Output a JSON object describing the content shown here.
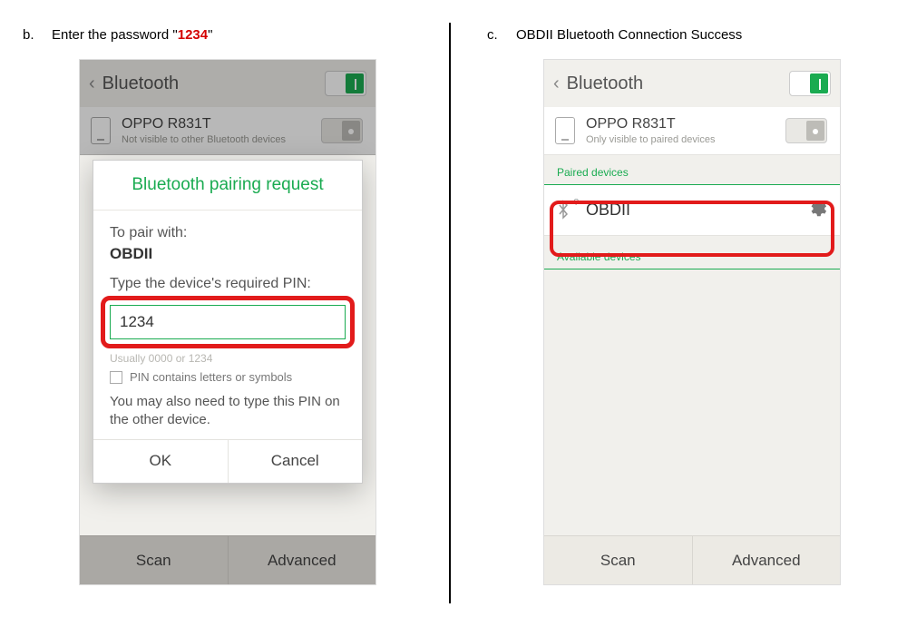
{
  "captions": {
    "b_letter": "b.",
    "b_prefix": "Enter the password \"",
    "b_password": "1234",
    "b_suffix": "\"",
    "c_letter": "c.",
    "c_text": "OBDII Bluetooth Connection Success"
  },
  "screen_b": {
    "title": "Bluetooth",
    "device": {
      "name": "OPPO R831T",
      "sub": "Not visible to other Bluetooth devices"
    },
    "footer": {
      "scan": "Scan",
      "advanced": "Advanced"
    },
    "dialog": {
      "title": "Bluetooth pairing request",
      "pair_label": "To pair with:",
      "pair_target": "OBDII",
      "pin_prompt": "Type the device's required PIN:",
      "pin_value": "1234",
      "hint": "Usually 0000 or 1234",
      "checkbox_label": "PIN contains letters or symbols",
      "note": "You may also need to type this PIN on the other device.",
      "ok": "OK",
      "cancel": "Cancel"
    }
  },
  "screen_c": {
    "title": "Bluetooth",
    "device": {
      "name": "OPPO R831T",
      "sub": "Only visible to paired devices"
    },
    "sections": {
      "paired": "Paired devices",
      "available": "Available devices"
    },
    "paired_item": {
      "name": "OBDII"
    },
    "footer": {
      "scan": "Scan",
      "advanced": "Advanced"
    }
  }
}
